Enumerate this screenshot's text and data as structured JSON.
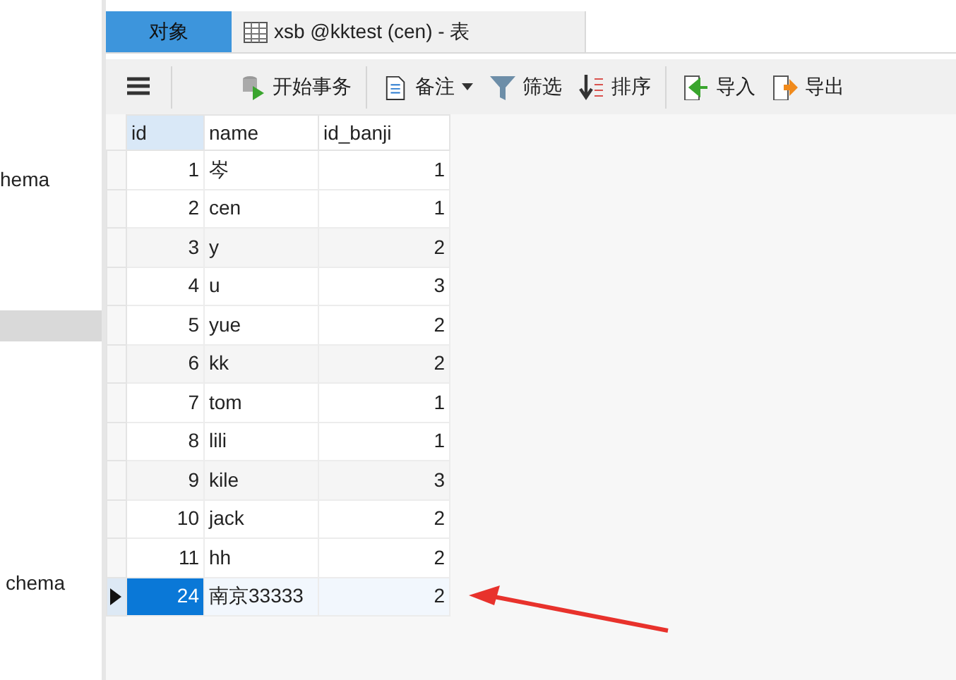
{
  "sidebar": {
    "items": [
      {
        "label": "hema",
        "selected": false
      },
      {
        "selected": true
      },
      {
        "label": "chema",
        "selected": false
      }
    ]
  },
  "tabs": [
    {
      "label": "对象",
      "selected": true,
      "kind": "plain"
    },
    {
      "label": "xsb @kktest (cen) - 表",
      "selected": false,
      "kind": "table"
    }
  ],
  "toolbar": [
    {
      "kind": "menu"
    },
    {
      "kind": "transaction",
      "label": "开始事务"
    },
    {
      "kind": "note",
      "label": "备注",
      "dropdown": true
    },
    {
      "kind": "filter",
      "label": "筛选"
    },
    {
      "kind": "sort",
      "label": "排序"
    },
    {
      "kind": "import",
      "label": "导入"
    },
    {
      "kind": "export",
      "label": "导出"
    }
  ],
  "table": {
    "columns": [
      "id",
      "name",
      "id_banji"
    ],
    "rows": [
      {
        "cells": [
          "1",
          "岑",
          "1"
        ],
        "selected": false
      },
      {
        "cells": [
          "2",
          "cen",
          "1"
        ],
        "selected": false
      },
      {
        "cells": [
          "3",
          "y",
          "2"
        ],
        "selected": false
      },
      {
        "cells": [
          "4",
          "u",
          "3"
        ],
        "selected": false
      },
      {
        "cells": [
          "5",
          "yue",
          "2"
        ],
        "selected": false
      },
      {
        "cells": [
          "6",
          "kk",
          "2"
        ],
        "selected": false
      },
      {
        "cells": [
          "7",
          "tom",
          "1"
        ],
        "selected": false
      },
      {
        "cells": [
          "8",
          "lili",
          "1"
        ],
        "selected": false
      },
      {
        "cells": [
          "9",
          "kile",
          "3"
        ],
        "selected": false
      },
      {
        "cells": [
          "10",
          "jack",
          "2"
        ],
        "selected": false
      },
      {
        "cells": [
          "11",
          "hh",
          "2"
        ],
        "selected": false
      },
      {
        "cells": [
          "24",
          "南京33333",
          "2"
        ],
        "selected": true
      }
    ]
  },
  "annotation": {
    "kind": "arrow"
  }
}
